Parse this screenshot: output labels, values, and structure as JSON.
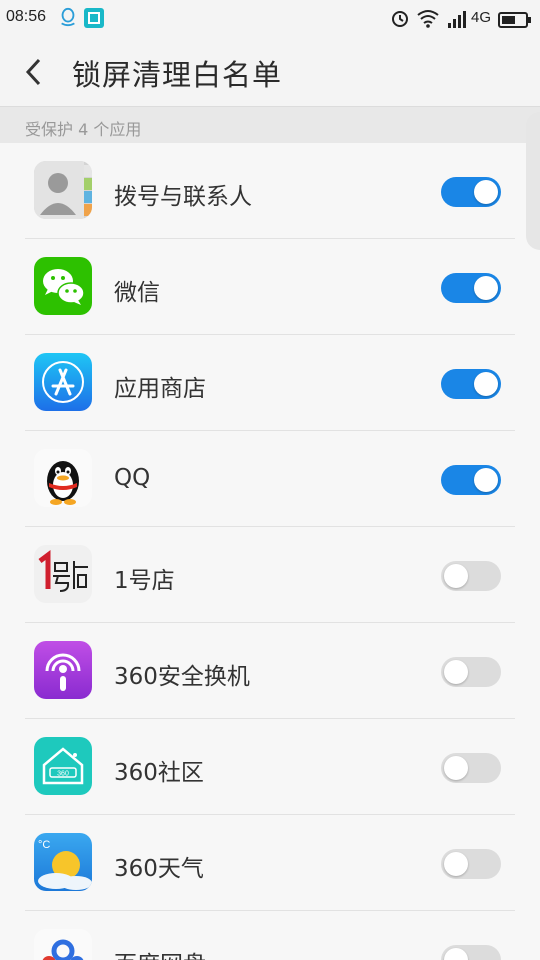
{
  "status_bar": {
    "time": "08:56",
    "network": "4G"
  },
  "header": {
    "title": "锁屏清理白名单"
  },
  "section": {
    "header": "受保护 4 个应用"
  },
  "apps": [
    {
      "name": "拨号与联系人",
      "enabled": true,
      "icon": "contacts-icon"
    },
    {
      "name": "微信",
      "enabled": true,
      "icon": "wechat-icon"
    },
    {
      "name": "应用商店",
      "enabled": true,
      "icon": "app-store-icon"
    },
    {
      "name": "QQ",
      "enabled": true,
      "icon": "qq-icon"
    },
    {
      "name": "1号店",
      "enabled": false,
      "icon": "yhd-icon"
    },
    {
      "name": "360安全换机",
      "enabled": false,
      "icon": "360-switch-icon"
    },
    {
      "name": "360社区",
      "enabled": false,
      "icon": "360-community-icon"
    },
    {
      "name": "360天气",
      "enabled": false,
      "icon": "360-weather-icon"
    },
    {
      "name": "百度网盘",
      "enabled": false,
      "icon": "baidu-netdisk-icon"
    }
  ],
  "colors": {
    "toggle_on": "#1a86e6",
    "toggle_off": "#dcdcdc",
    "wechat": "#2dc100"
  }
}
